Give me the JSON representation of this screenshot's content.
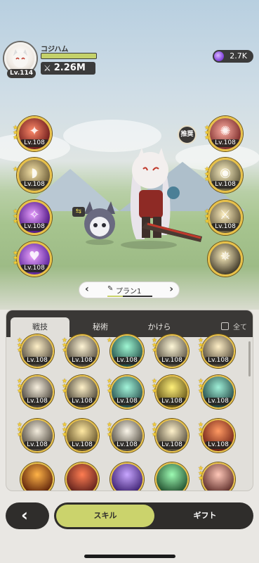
{
  "player": {
    "name": "コジハム",
    "level": "Lv.114",
    "power": "2.26M",
    "hp_fill": 1.0
  },
  "currency": {
    "gems": "2.7K"
  },
  "equipped_left": [
    {
      "lv": "Lv.108",
      "stars": 3,
      "c1": "#ff8a6a",
      "c2": "#6b1a1a",
      "glyph": "✦"
    },
    {
      "lv": "Lv.108",
      "stars": 1,
      "c1": "#f6e3a8",
      "c2": "#6a5a36",
      "glyph": "◗"
    },
    {
      "lv": "Lv.108",
      "stars": 3,
      "c1": "#e8a0ff",
      "c2": "#4a1280",
      "glyph": "✧"
    },
    {
      "lv": "Lv.108",
      "stars": 3,
      "c1": "#f0a8ff",
      "c2": "#57209a",
      "glyph": "♥"
    }
  ],
  "equipped_right": [
    {
      "lv": "Lv.108",
      "stars": 3,
      "c1": "#ffb1a6",
      "c2": "#7a2a28",
      "glyph": "✺"
    },
    {
      "lv": "Lv.108",
      "stars": 3,
      "c1": "#fff3c7",
      "c2": "#615a3c",
      "glyph": "◉"
    },
    {
      "lv": "Lv.108",
      "stars": 3,
      "c1": "#fff0c0",
      "c2": "#5d5236",
      "glyph": "⚔"
    },
    {
      "lv": "",
      "stars": 0,
      "c1": "#fff1c0",
      "c2": "#3f3828",
      "glyph": "✵"
    }
  ],
  "recommend_label": "推奨",
  "plan": {
    "label": "プラン1"
  },
  "tabs": [
    {
      "label": "戦技"
    },
    {
      "label": "秘術"
    },
    {
      "label": "かけら"
    }
  ],
  "all_label": "全て",
  "skill_grid": [
    {
      "lv": "Lv.108",
      "stars": 3,
      "c1": "#fff0c8",
      "c2": "#4f473a"
    },
    {
      "lv": "Lv.108",
      "stars": 3,
      "c1": "#fff5d5",
      "c2": "#4c4437"
    },
    {
      "lv": "Lv.108",
      "stars": 1,
      "c1": "#9ff7d3",
      "c2": "#1f4a44"
    },
    {
      "lv": "Lv.108",
      "stars": 3,
      "c1": "#fff8d8",
      "c2": "#51493b"
    },
    {
      "lv": "Lv.108",
      "stars": 3,
      "c1": "#ffefc6",
      "c2": "#4e4535"
    },
    {
      "lv": "Lv.108",
      "stars": 3,
      "c1": "#f8f0df",
      "c2": "#403a31"
    },
    {
      "lv": "Lv.108",
      "stars": 3,
      "c1": "#fff2c9",
      "c2": "#3e372b"
    },
    {
      "lv": "Lv.108",
      "stars": 3,
      "c1": "#a3f5da",
      "c2": "#234a48"
    },
    {
      "lv": "Lv.108",
      "stars": 3,
      "c1": "#fff07a",
      "c2": "#5d4c12"
    },
    {
      "lv": "Lv.108",
      "stars": 3,
      "c1": "#9ff0d8",
      "c2": "#1e403e"
    },
    {
      "lv": "Lv.108",
      "stars": 3,
      "c1": "#f3ecdd",
      "c2": "#4a4338"
    },
    {
      "lv": "Lv.108",
      "stars": 3,
      "c1": "#ffe9a3",
      "c2": "#5a4820"
    },
    {
      "lv": "Lv.108",
      "stars": 3,
      "c1": "#fbf6ea",
      "c2": "#4c463a"
    },
    {
      "lv": "Lv.108",
      "stars": 3,
      "c1": "#fff2cb",
      "c2": "#4c4434"
    },
    {
      "lv": "Lv.108",
      "stars": 3,
      "c1": "#ff9a63",
      "c2": "#6b1e12"
    },
    {
      "lv": "",
      "stars": 0,
      "c1": "#ffb347",
      "c2": "#5a1f08"
    },
    {
      "lv": "",
      "stars": 0,
      "c1": "#ff7d52",
      "c2": "#5a1e1a"
    },
    {
      "lv": "",
      "stars": 0,
      "c1": "#c8a6ff",
      "c2": "#3a1e6e"
    },
    {
      "lv": "",
      "stars": 0,
      "c1": "#9dfbb3",
      "c2": "#1e4a2a"
    },
    {
      "lv": "",
      "stars": 3,
      "c1": "#ffc7b8",
      "c2": "#5a2a26"
    }
  ],
  "bottom": {
    "back_icon": "‹",
    "skill_label": "スキル",
    "gift_label": "ギフト"
  },
  "colors": {
    "accent": "#cbd36c",
    "frame": "#e8c14a",
    "dark": "#2f2d2b"
  }
}
